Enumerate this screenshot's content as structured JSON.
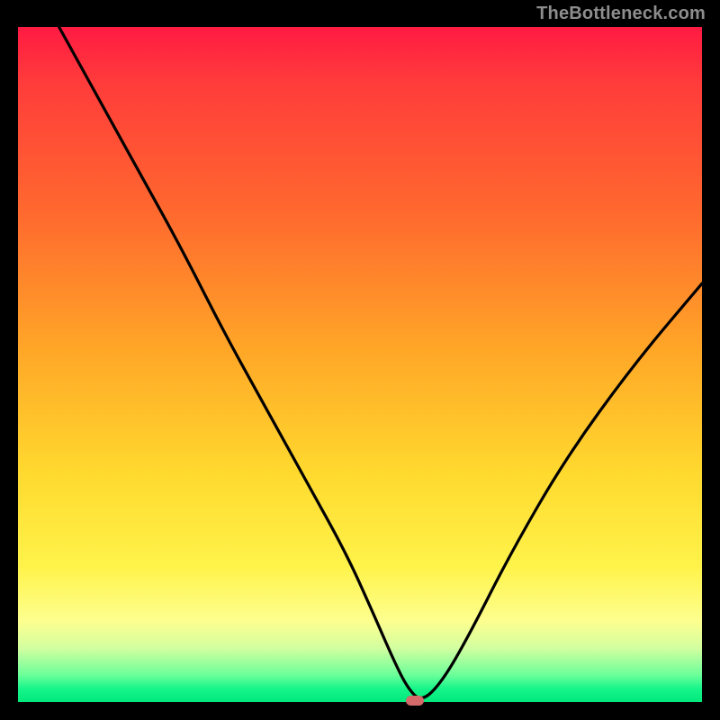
{
  "watermark": "TheBottleneck.com",
  "chart_data": {
    "type": "line",
    "title": "",
    "xlabel": "",
    "ylabel": "",
    "xlim": [
      0,
      100
    ],
    "ylim": [
      0,
      100
    ],
    "background_gradient": {
      "direction": "vertical",
      "stops": [
        {
          "pos": 0,
          "color": "#ff1a43"
        },
        {
          "pos": 0.28,
          "color": "#ff6a2e"
        },
        {
          "pos": 0.66,
          "color": "#ffd92e"
        },
        {
          "pos": 0.88,
          "color": "#fdff8f"
        },
        {
          "pos": 1.0,
          "color": "#00e87c"
        }
      ]
    },
    "series": [
      {
        "name": "bottleneck-curve",
        "x": [
          6,
          12,
          18,
          24,
          30,
          36,
          42,
          48,
          52,
          55,
          57,
          59,
          62,
          66,
          72,
          80,
          90,
          100
        ],
        "y": [
          100,
          89,
          78,
          67,
          55,
          44,
          33,
          22,
          13,
          6,
          2,
          0,
          3,
          10,
          22,
          36,
          50,
          62
        ]
      }
    ],
    "marker": {
      "x": 58,
      "y": 0,
      "color": "#d46a6a"
    }
  }
}
